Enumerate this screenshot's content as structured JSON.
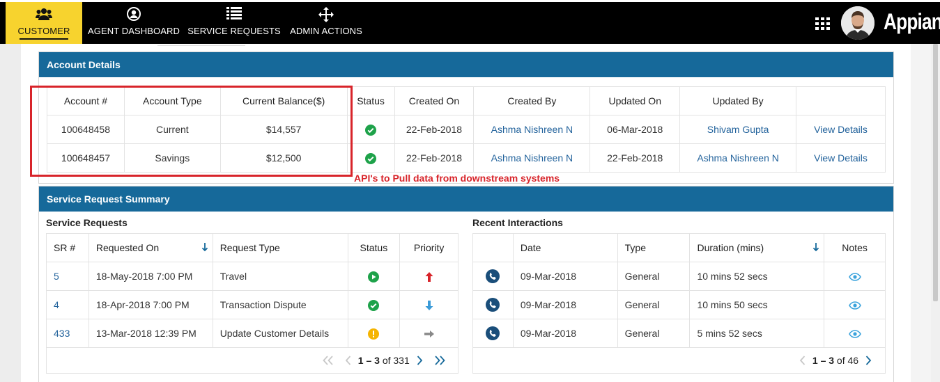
{
  "nav": {
    "items": [
      {
        "label": "CUSTOMER",
        "icon": "users-icon",
        "active": true
      },
      {
        "label": "AGENT DASHBOARD",
        "icon": "user-circle-icon"
      },
      {
        "label": "SERVICE REQUESTS",
        "icon": "list-icon"
      },
      {
        "label": "ADMIN ACTIONS",
        "icon": "move-arrows-icon"
      }
    ],
    "brand": "Appian",
    "accent": "#f7d32e"
  },
  "account_details": {
    "title": "Account Details",
    "columns": [
      "Account #",
      "Account Type",
      "Current Balance($)",
      "Status",
      "Created On",
      "Created By",
      "Updated On",
      "Updated By",
      ""
    ],
    "rows": [
      {
        "account": "100648458",
        "type": "Current",
        "balance": "$14,557",
        "status": "check-circle-icon",
        "created_on": "22-Feb-2018",
        "created_by": "Ashma Nishreen N",
        "updated_on": "06-Mar-2018",
        "updated_by": "Shivam Gupta",
        "action": "View Details"
      },
      {
        "account": "100648457",
        "type": "Savings",
        "balance": "$12,500",
        "status": "check-circle-icon",
        "created_on": "22-Feb-2018",
        "created_by": "Ashma Nishreen N",
        "updated_on": "22-Feb-2018",
        "updated_by": "Ashma Nishreen N",
        "action": "View Details"
      }
    ],
    "annotation": "API's to Pull data from downstream systems"
  },
  "service_summary": {
    "title": "Service Request Summary",
    "service_requests": {
      "title": "Service Requests",
      "columns": [
        "SR #",
        "Requested On",
        "Request Type",
        "Status",
        "Priority"
      ],
      "rows": [
        {
          "sr": "5",
          "requested_on": "18-May-2018 7:00 PM",
          "type": "Travel",
          "status": "play-circle-icon",
          "priority": "arrow-up-icon"
        },
        {
          "sr": "4",
          "requested_on": "18-Apr-2018 7:00 PM",
          "type": "Transaction Dispute",
          "status": "check-circle-icon",
          "priority": "arrow-down-icon"
        },
        {
          "sr": "433",
          "requested_on": "13-Mar-2018 12:39 PM",
          "type": "Update Customer Details",
          "status": "warning-circle-icon",
          "priority": "arrow-right-icon"
        }
      ],
      "pager": {
        "range": "1 – 3",
        "of_label": "of 331"
      }
    },
    "recent_interactions": {
      "title": "Recent Interactions",
      "columns": [
        "",
        "Date",
        "Type",
        "Duration (mins)",
        "Notes"
      ],
      "rows": [
        {
          "date": "09-Mar-2018",
          "type": "General",
          "duration": "10 mins 52 secs"
        },
        {
          "date": "09-Mar-2018",
          "type": "General",
          "duration": "10 mins 50 secs"
        },
        {
          "date": "09-Mar-2018",
          "type": "General",
          "duration": "5 mins 52 secs"
        }
      ],
      "pager": {
        "range": "1 – 3",
        "of_label": "of 46"
      }
    }
  },
  "colors": {
    "header_blue": "#16699a",
    "link": "#23639c",
    "green": "#1ea24a",
    "red": "#d8242a",
    "priority_blue": "#3b9bd8"
  }
}
